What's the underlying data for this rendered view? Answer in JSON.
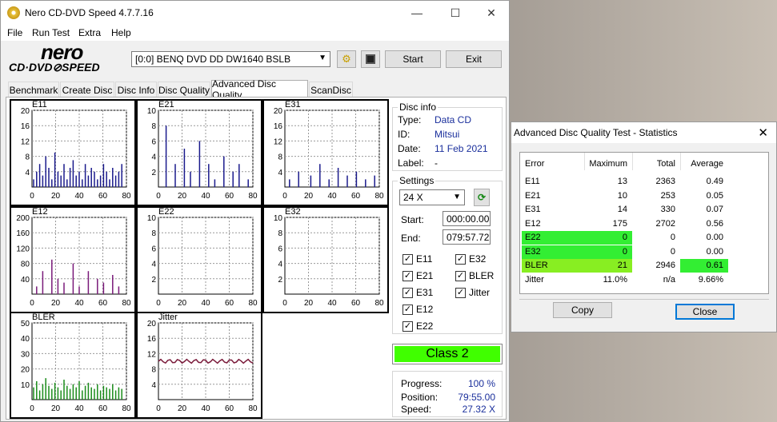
{
  "window": {
    "title": "Nero CD-DVD Speed 4.7.7.16",
    "minimize": "—",
    "maximize": "☐",
    "close": "✕"
  },
  "menu": [
    "File",
    "Run Test",
    "Extra",
    "Help"
  ],
  "logo": {
    "top": "nero",
    "bottom": "CD·DVD⊘SPEED"
  },
  "drive": {
    "value": "[0:0]  BENQ DVD DD DW1640 BSLB"
  },
  "buttons": {
    "start": "Start",
    "exit": "Exit"
  },
  "tabs": [
    "Benchmark",
    "Create Disc",
    "Disc Info",
    "Disc Quality",
    "Advanced Disc Quality",
    "ScanDisc"
  ],
  "active_tab": "Advanced Disc Quality",
  "charts": [
    {
      "name": "E11",
      "yticks": [
        "20",
        "16",
        "12",
        "8",
        "4"
      ],
      "xticks": [
        "0",
        "20",
        "40",
        "60",
        "80"
      ]
    },
    {
      "name": "E21",
      "yticks": [
        "10",
        "8",
        "6",
        "4",
        "2"
      ],
      "xticks": [
        "0",
        "20",
        "40",
        "60",
        "80"
      ]
    },
    {
      "name": "E31",
      "yticks": [
        "20",
        "16",
        "12",
        "8",
        "4"
      ],
      "xticks": [
        "0",
        "20",
        "40",
        "60",
        "80"
      ]
    },
    {
      "name": "E12",
      "yticks": [
        "200",
        "160",
        "120",
        "80",
        "40"
      ],
      "xticks": [
        "0",
        "20",
        "40",
        "60",
        "80"
      ]
    },
    {
      "name": "E22",
      "yticks": [
        "10",
        "8",
        "6",
        "4",
        "2"
      ],
      "xticks": [
        "0",
        "20",
        "40",
        "60",
        "80"
      ]
    },
    {
      "name": "E32",
      "yticks": [
        "10",
        "8",
        "6",
        "4",
        "2"
      ],
      "xticks": [
        "0",
        "20",
        "40",
        "60",
        "80"
      ]
    },
    {
      "name": "BLER",
      "yticks": [
        "50",
        "40",
        "30",
        "20",
        "10"
      ],
      "xticks": [
        "0",
        "20",
        "40",
        "60",
        "80"
      ]
    },
    {
      "name": "Jitter",
      "yticks": [
        "20",
        "16",
        "12",
        "8",
        "4"
      ],
      "xticks": [
        "0",
        "20",
        "40",
        "60",
        "80"
      ]
    }
  ],
  "disc_info": {
    "heading": "Disc info",
    "type_label": "Type:",
    "type": "Data CD",
    "id_label": "ID:",
    "id": "Mitsui",
    "date_label": "Date:",
    "date": "11 Feb 2021",
    "label_label": "Label:",
    "label": "-"
  },
  "settings": {
    "heading": "Settings",
    "speed": "24 X",
    "start_label": "Start:",
    "start": "000:00.00",
    "end_label": "End:",
    "end": "079:57.72",
    "checks": [
      {
        "label": "E11",
        "checked": true
      },
      {
        "label": "E32",
        "checked": true
      },
      {
        "label": "E21",
        "checked": true
      },
      {
        "label": "BLER",
        "checked": true
      },
      {
        "label": "E31",
        "checked": true
      },
      {
        "label": "Jitter",
        "checked": true
      },
      {
        "label": "E12",
        "checked": true
      },
      {
        "label": "E22",
        "checked": true
      }
    ]
  },
  "class": {
    "label": "Class 2",
    "color": "#40ff00"
  },
  "progress": {
    "progress_label": "Progress:",
    "progress": "100 %",
    "position_label": "Position:",
    "position": "79:55.00",
    "speed_label": "Speed:",
    "speed": "27.32 X"
  },
  "stats": {
    "title": "Advanced Disc Quality Test - Statistics",
    "headers": [
      "Error",
      "Maximum",
      "Total",
      "Average"
    ],
    "rows": [
      [
        "E11",
        "13",
        "2363",
        "0.49"
      ],
      [
        "E21",
        "10",
        "253",
        "0.05"
      ],
      [
        "E31",
        "14",
        "330",
        "0.07"
      ],
      [
        "E12",
        "175",
        "2702",
        "0.56"
      ],
      [
        "E22",
        "0",
        "0",
        "0.00"
      ],
      [
        "E32",
        "0",
        "0",
        "0.00"
      ],
      [
        "BLER",
        "21",
        "2946",
        "0.61"
      ],
      [
        "Jitter",
        "11.0%",
        "n/a",
        "9.66%"
      ]
    ],
    "copy": "Copy",
    "close": "Close"
  }
}
